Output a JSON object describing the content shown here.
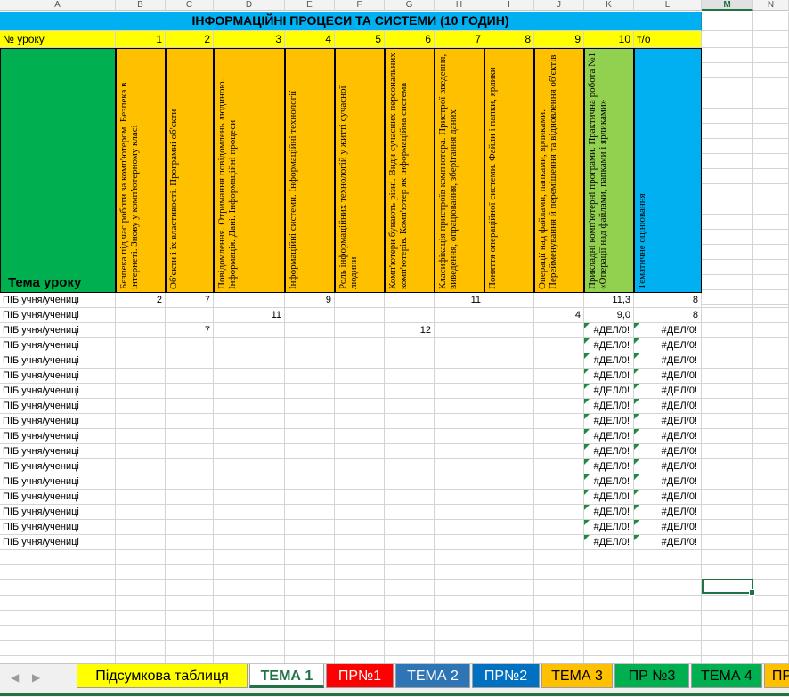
{
  "columns": [
    "A",
    "B",
    "C",
    "D",
    "E",
    "F",
    "G",
    "H",
    "I",
    "J",
    "K",
    "L",
    "M",
    "N"
  ],
  "selected_column": "M",
  "title": "ІНФОРМАЦІЙНІ ПРОЦЕСИ ТА СИСТЕМИ   (10 ГОДИН)",
  "lesson_row": {
    "label": "№ уроку",
    "numbers": [
      "1",
      "2",
      "3",
      "4",
      "5",
      "6",
      "7",
      "8",
      "9",
      "10"
    ],
    "to_label": "т/о"
  },
  "topic_label": "Тема уроку",
  "lesson_topics": [
    "Безпека під час роботи за комп'ютером. Безпека в інтернеті. Знову у комп'ютерному класі",
    "Об'єкти і їх властивості. Програмні об'єкти",
    "Повідомлення. Отримання повідомлень людиною. Інформація. Дані. Інформаційні процеси",
    "Інформаційні системи. Інформаційні технології",
    "Роль інформаційних технологій у житті сучасної людини",
    "Комп'ютери бувають різні. Види сучасних персональних комп'ютерів. Комп'ютер як інформаційна система",
    "Класифікація пристроїв комп'ютера. Пристрої введення, виведення, опрацювання, зберігання даних",
    "Поняття операційної системи. Файли і папки, ярлики",
    "Операції над файлами, папками, ярликами. Перейменування й переміщення та відновлення об'єктів",
    "Прикладні комп'ютерні програми. Практична робота №1 «Операції над файлами, папками і ярликами»",
    "Тематичне оцінювання"
  ],
  "student_label": "ПІБ учня/учениці",
  "rows": [
    {
      "grades": [
        "2",
        "7",
        "",
        "9",
        "",
        "",
        "11",
        "",
        "",
        ""
      ],
      "avg": "11,3",
      "to": "8",
      "flag": false
    },
    {
      "grades": [
        "",
        "",
        "11",
        "",
        "",
        "",
        "",
        "",
        "4",
        ""
      ],
      "avg": "9,0",
      "to": "8",
      "flag": false
    },
    {
      "grades": [
        "",
        "7",
        "",
        "",
        "",
        "12",
        "",
        "",
        "",
        ""
      ],
      "avg": "#ДЕЛ/0!",
      "to": "#ДЕЛ/0!",
      "flag": true
    },
    {
      "grades": [
        "",
        "",
        "",
        "",
        "",
        "",
        "",
        "",
        "",
        ""
      ],
      "avg": "#ДЕЛ/0!",
      "to": "#ДЕЛ/0!",
      "flag": true
    },
    {
      "grades": [
        "",
        "",
        "",
        "",
        "",
        "",
        "",
        "",
        "",
        ""
      ],
      "avg": "#ДЕЛ/0!",
      "to": "#ДЕЛ/0!",
      "flag": true
    },
    {
      "grades": [
        "",
        "",
        "",
        "",
        "",
        "",
        "",
        "",
        "",
        ""
      ],
      "avg": "#ДЕЛ/0!",
      "to": "#ДЕЛ/0!",
      "flag": true
    },
    {
      "grades": [
        "",
        "",
        "",
        "",
        "",
        "",
        "",
        "",
        "",
        ""
      ],
      "avg": "#ДЕЛ/0!",
      "to": "#ДЕЛ/0!",
      "flag": true
    },
    {
      "grades": [
        "",
        "",
        "",
        "",
        "",
        "",
        "",
        "",
        "",
        ""
      ],
      "avg": "#ДЕЛ/0!",
      "to": "#ДЕЛ/0!",
      "flag": true
    },
    {
      "grades": [
        "",
        "",
        "",
        "",
        "",
        "",
        "",
        "",
        "",
        ""
      ],
      "avg": "#ДЕЛ/0!",
      "to": "#ДЕЛ/0!",
      "flag": true
    },
    {
      "grades": [
        "",
        "",
        "",
        "",
        "",
        "",
        "",
        "",
        "",
        ""
      ],
      "avg": "#ДЕЛ/0!",
      "to": "#ДЕЛ/0!",
      "flag": true
    },
    {
      "grades": [
        "",
        "",
        "",
        "",
        "",
        "",
        "",
        "",
        "",
        ""
      ],
      "avg": "#ДЕЛ/0!",
      "to": "#ДЕЛ/0!",
      "flag": true
    },
    {
      "grades": [
        "",
        "",
        "",
        "",
        "",
        "",
        "",
        "",
        "",
        ""
      ],
      "avg": "#ДЕЛ/0!",
      "to": "#ДЕЛ/0!",
      "flag": true
    },
    {
      "grades": [
        "",
        "",
        "",
        "",
        "",
        "",
        "",
        "",
        "",
        ""
      ],
      "avg": "#ДЕЛ/0!",
      "to": "#ДЕЛ/0!",
      "flag": true
    },
    {
      "grades": [
        "",
        "",
        "",
        "",
        "",
        "",
        "",
        "",
        "",
        ""
      ],
      "avg": "#ДЕЛ/0!",
      "to": "#ДЕЛ/0!",
      "flag": true
    },
    {
      "grades": [
        "",
        "",
        "",
        "",
        "",
        "",
        "",
        "",
        "",
        ""
      ],
      "avg": "#ДЕЛ/0!",
      "to": "#ДЕЛ/0!",
      "flag": true
    },
    {
      "grades": [
        "",
        "",
        "",
        "",
        "",
        "",
        "",
        "",
        "",
        ""
      ],
      "avg": "#ДЕЛ/0!",
      "to": "#ДЕЛ/0!",
      "flag": true
    },
    {
      "grades": [
        "",
        "",
        "",
        "",
        "",
        "",
        "",
        "",
        "",
        ""
      ],
      "avg": "#ДЕЛ/0!",
      "to": "#ДЕЛ/0!",
      "flag": true
    }
  ],
  "colors": {
    "title_bg": "#00b0f0",
    "lesson_row_bg": "#ffff00",
    "topic_bg": "#00b050",
    "lesson_header_bg": "#ffc000",
    "practice_header_bg": "#92d050",
    "assessment_header_bg": "#00b0f0",
    "excel_green": "#217346"
  },
  "sheet_nav": {
    "prev_icon": "sheet-prev-icon",
    "next_icon": "sheet-next-icon",
    "prev": "◀",
    "next": "▶"
  },
  "sheet_tabs": [
    {
      "label": "Підсумкова таблиця",
      "bg": "#ffff00",
      "color": "#000000",
      "active": false
    },
    {
      "label": "ТЕМА 1",
      "bg": "#ffffff",
      "color": "#217346",
      "active": true
    },
    {
      "label": "ПР№1",
      "bg": "#ff0000",
      "color": "#ffffff",
      "active": false
    },
    {
      "label": "ТЕМА 2",
      "bg": "#2e75b6",
      "color": "#ffffff",
      "active": false
    },
    {
      "label": "ПР№2",
      "bg": "#0070c0",
      "color": "#ffffff",
      "active": false
    },
    {
      "label": "ТЕМА 3",
      "bg": "#ffc000",
      "color": "#000000",
      "active": false
    },
    {
      "label": "ПР №3",
      "bg": "#00b050",
      "color": "#000000",
      "active": false
    },
    {
      "label": "ТЕМА 4",
      "bg": "#00b050",
      "color": "#000000",
      "active": false
    },
    {
      "label": "ПР",
      "bg": "#ffc000",
      "color": "#000000",
      "active": false
    }
  ]
}
